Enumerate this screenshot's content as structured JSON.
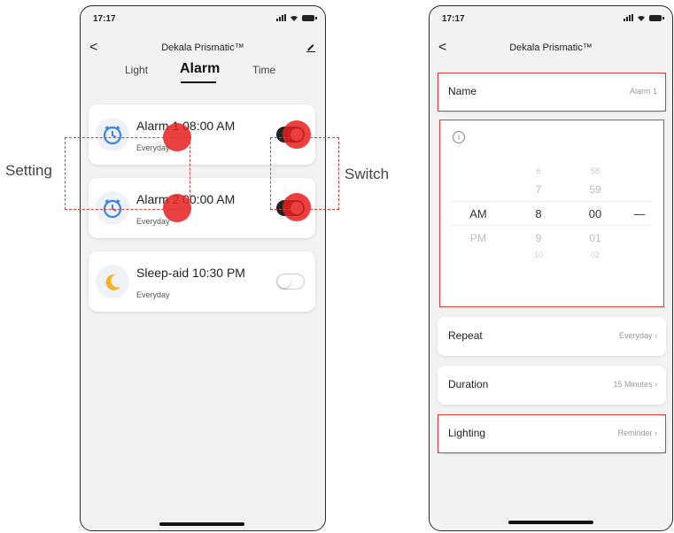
{
  "status_bar": {
    "time": "17:17"
  },
  "left_screen": {
    "back": "<",
    "title": "Dekala Prismatic™",
    "tabs": [
      {
        "label": "Light",
        "active": false
      },
      {
        "label": "Alarm",
        "active": true
      },
      {
        "label": "Time",
        "active": false
      }
    ],
    "alarms": [
      {
        "name": "Alarm 1 08:00 AM",
        "repeat": "Everyday",
        "enabled": true,
        "icon": "alarm-clock-icon"
      },
      {
        "name": "Alarm 2 00:00 AM",
        "repeat": "Everyday",
        "enabled": true,
        "icon": "alarm-clock-icon"
      },
      {
        "name": "Sleep-aid 10:30 PM",
        "repeat": "Everyday",
        "enabled": false,
        "icon": "moon-icon"
      }
    ]
  },
  "annotations": {
    "setting_label": "Setting",
    "switch_label": "Switch",
    "highlight_color": "#e03b3b"
  },
  "right_screen": {
    "back": "<",
    "title": "Dekala Prismatic™",
    "name": {
      "label": "Name",
      "value": "Alarm 1"
    },
    "picker": {
      "ampm": [
        "AM",
        "PM"
      ],
      "hours": [
        "6",
        "7",
        "8",
        "9",
        "10"
      ],
      "minutes": [
        "58",
        "59",
        "00",
        "01",
        "02"
      ],
      "selected_hour": "8",
      "selected_minute": "00",
      "selected_ampm": "AM",
      "separator": "—"
    },
    "repeat": {
      "label": "Repeat",
      "value": "Everyday"
    },
    "duration": {
      "label": "Duration",
      "value": "15 Minutes"
    },
    "lighting": {
      "label": "Lighting",
      "value": "Reminder"
    }
  }
}
